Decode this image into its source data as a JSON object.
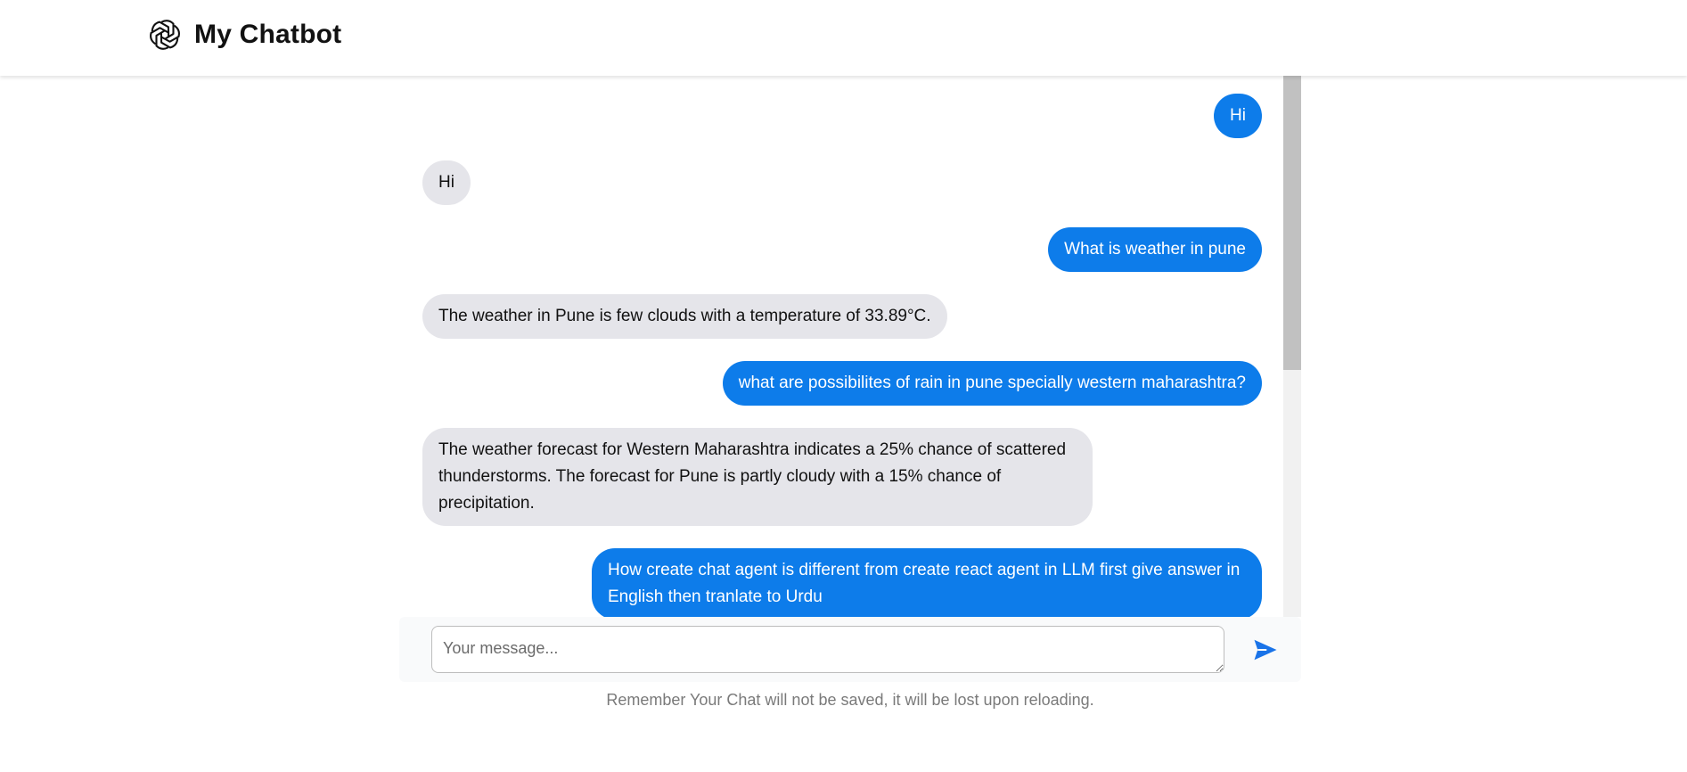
{
  "header": {
    "title": "My Chatbot",
    "logo_icon": "openai-logo-icon"
  },
  "messages": [
    {
      "role": "user",
      "text": "Hi"
    },
    {
      "role": "bot",
      "text": "Hi"
    },
    {
      "role": "user",
      "text": "What is weather in pune"
    },
    {
      "role": "bot",
      "text": "The weather in Pune is few clouds with a temperature of 33.89°C."
    },
    {
      "role": "user",
      "text": "what are possibilites of rain in pune specially western maharashtra?"
    },
    {
      "role": "bot",
      "text": "The weather forecast for Western Maharashtra indicates a 25% chance of scattered thunderstorms. The forecast for Pune is partly cloudy with a 15% chance of precipitation."
    },
    {
      "role": "user",
      "text": "How create chat agent is different from create react agent in LLM first give answer in English then tranlate to Urdu"
    }
  ],
  "composer": {
    "placeholder": "Your message...",
    "value": "",
    "send_icon": "send-icon"
  },
  "footer": {
    "note": "Remember Your Chat will not be saved, it will be lost upon reloading."
  },
  "colors": {
    "user_bubble": "#0d7cea",
    "bot_bubble": "#e5e5ea",
    "send_accent": "#1a73e8"
  }
}
